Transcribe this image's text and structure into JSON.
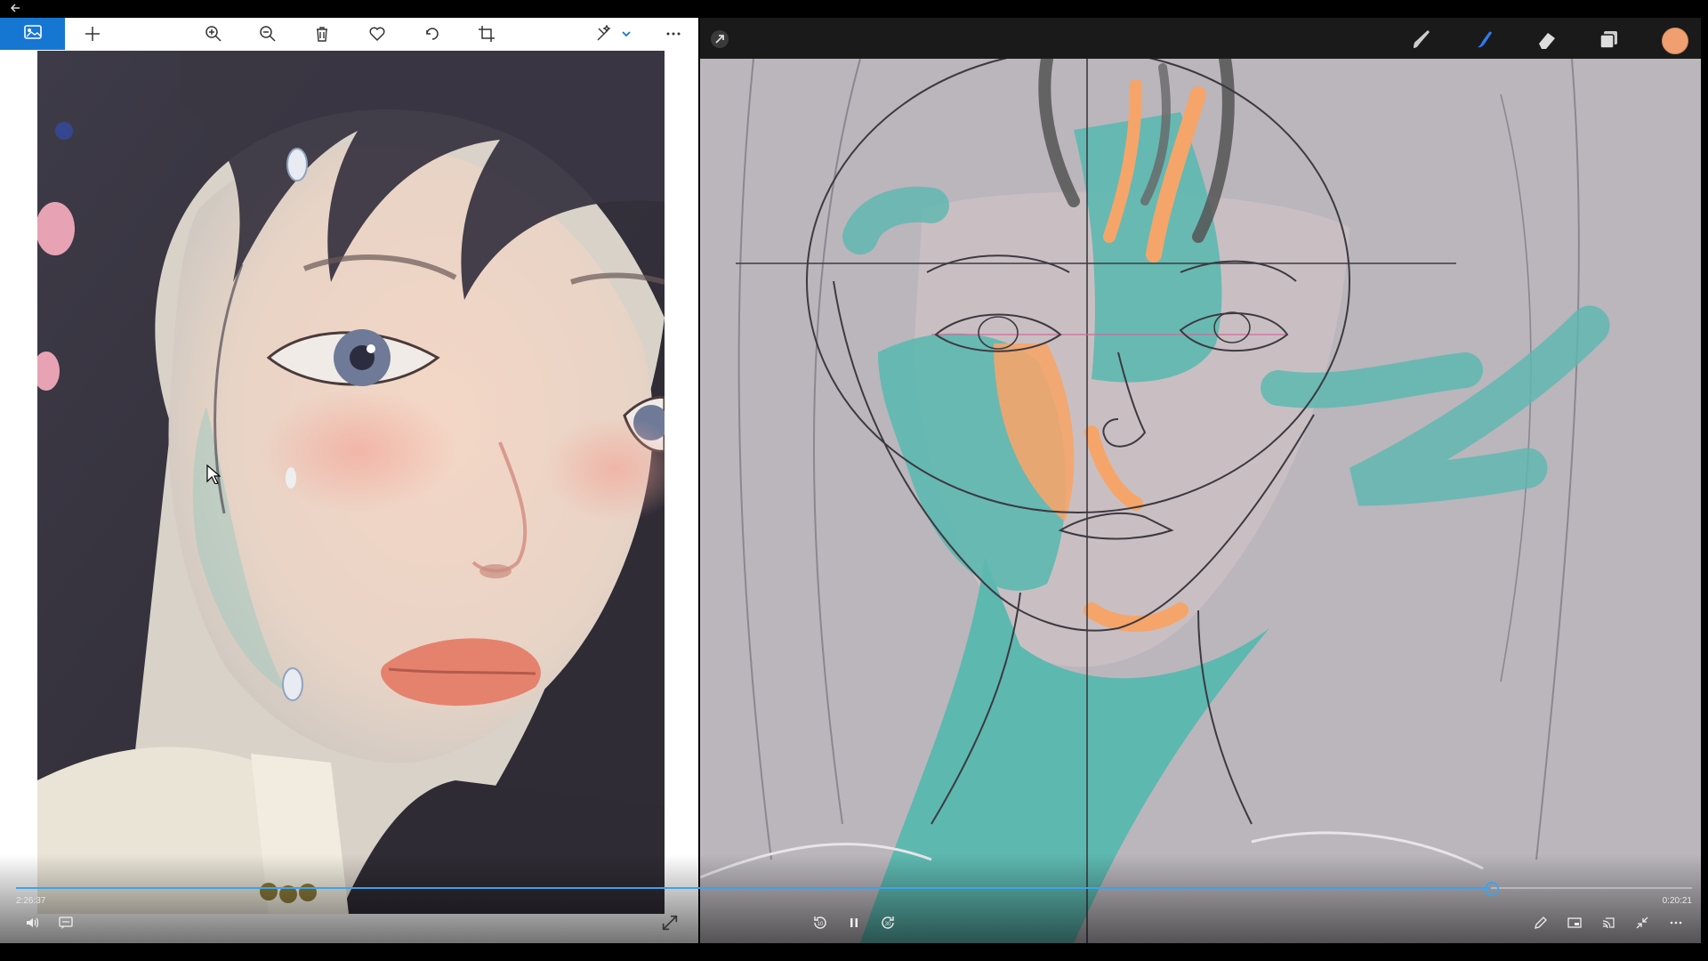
{
  "window": {
    "back_icon": "back-arrow-icon"
  },
  "viewer": {
    "toolbar": {
      "home_icon": "photos-app-icon",
      "tools": [
        "add-icon",
        "zoom-in-icon",
        "zoom-out-icon",
        "delete-icon",
        "favorite-icon",
        "rotate-icon",
        "crop-icon",
        "edit-enhance-icon",
        "dropdown-chevron-icon",
        "more-icon"
      ]
    },
    "image": {
      "subject": "painted portrait of a girl with dark hair, pastel skin tones and red lips"
    }
  },
  "drawing_app": {
    "toolbar": {
      "tools": [
        "cursor-action-icon",
        "brush-icon",
        "smudge-icon",
        "eraser-icon",
        "layers-icon"
      ],
      "color_swatch": "#F0A070"
    },
    "canvas": {
      "subject": "face construction sketch with teal and orange blocking colors"
    }
  },
  "player": {
    "elapsed_time": "2:26:37",
    "remaining_time": "0:20:21",
    "progress_fraction": 0.88,
    "accent_color": "#3EA3E8",
    "controls_left": [
      "volume-icon",
      "captions-icon"
    ],
    "controls_center": [
      "skip-back-10-icon",
      "pause-icon",
      "skip-forward-30-icon"
    ],
    "controls_right": [
      "draw-icon",
      "miniplayer-icon",
      "cast-icon",
      "exit-fullscreen-icon",
      "more-icon"
    ],
    "expand_icon": "expand-icon"
  },
  "colors": {
    "canvas_bg": "#B9B6BC",
    "teal_paint": "#5DB8B0",
    "orange_paint": "#F5A56A",
    "viewer_accent": "#1677D2"
  }
}
